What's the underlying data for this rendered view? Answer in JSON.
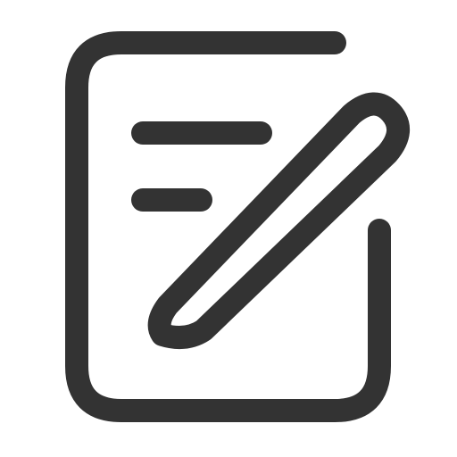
{
  "icon": {
    "name": "edit-note-icon",
    "stroke_color": "#333333",
    "background_color": "#ffffff"
  }
}
